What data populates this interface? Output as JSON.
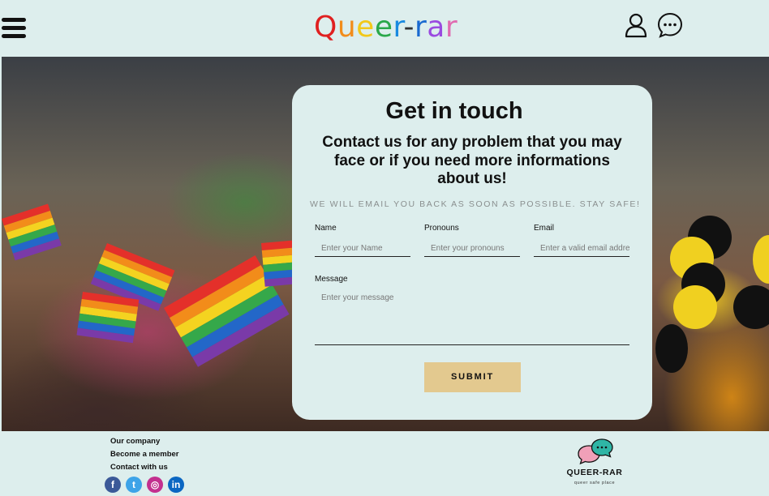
{
  "header": {
    "logo_letters": [
      "Q",
      "u",
      "e",
      "e",
      "r",
      "-",
      "r",
      "a",
      "r"
    ],
    "logo_colors": [
      "#e02020",
      "#f28c1a",
      "#f2c81a",
      "#2aa84a",
      "#1a8ae0",
      "#333333",
      "#1a6ad0",
      "#9a4ae0",
      "#e06ab0"
    ]
  },
  "icons": {
    "menu": "hamburger-menu-icon",
    "user": "user-icon",
    "chat": "chat-bubble-icon"
  },
  "contact": {
    "title": "Get in touch",
    "subtitle": "Contact us for any problem that you may face or if you need more informations about us!",
    "note": "WE WILL EMAIL YOU BACK AS SOON AS POSSIBLE. STAY SAFE!",
    "fields": {
      "name": {
        "label": "Name",
        "placeholder": "Enter your Name"
      },
      "pronouns": {
        "label": "Pronouns",
        "placeholder": "Enter your pronouns"
      },
      "email": {
        "label": "Email",
        "placeholder": "Enter a valid email address"
      },
      "message": {
        "label": "Message",
        "placeholder": "Enter your message"
      }
    },
    "submit_label": "SUBMIT"
  },
  "footer": {
    "links": [
      "Our company",
      "Become a member",
      "Contact with us"
    ],
    "social": [
      {
        "name": "facebook-icon",
        "glyph": "f",
        "color": "#3b5998"
      },
      {
        "name": "twitter-icon",
        "glyph": "t",
        "color": "#3da3e8"
      },
      {
        "name": "instagram-icon",
        "glyph": "◎",
        "color": "#c3308f"
      },
      {
        "name": "linkedin-icon",
        "glyph": "in",
        "color": "#0a66c2"
      }
    ],
    "brand_name": "QUEER-RAR",
    "tagline": "queer safe place"
  }
}
